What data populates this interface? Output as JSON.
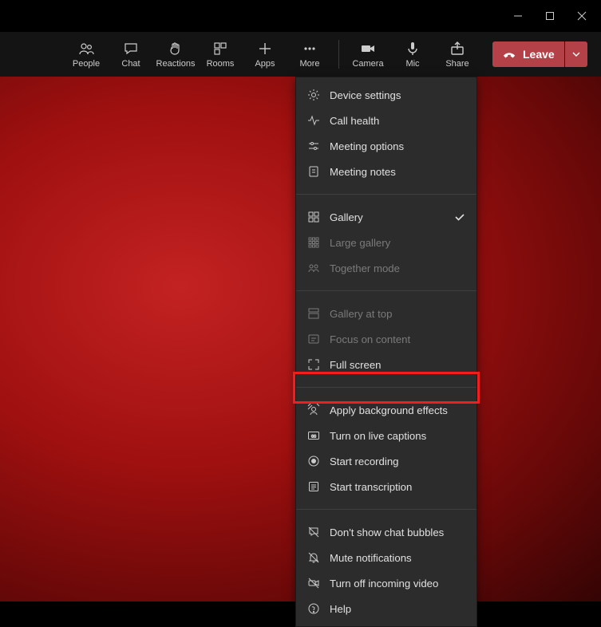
{
  "toolbar": {
    "people": "People",
    "chat": "Chat",
    "reactions": "Reactions",
    "rooms": "Rooms",
    "apps": "Apps",
    "more": "More",
    "camera": "Camera",
    "mic": "Mic",
    "share": "Share",
    "leave": "Leave"
  },
  "menu": {
    "group1": {
      "device_settings": "Device settings",
      "call_health": "Call health",
      "meeting_options": "Meeting options",
      "meeting_notes": "Meeting notes"
    },
    "group2": {
      "gallery": "Gallery",
      "large_gallery": "Large gallery",
      "together_mode": "Together mode"
    },
    "group3": {
      "gallery_at_top": "Gallery at top",
      "focus_on_content": "Focus on content",
      "full_screen": "Full screen"
    },
    "group4": {
      "apply_background": "Apply background effects",
      "live_captions": "Turn on live captions",
      "start_recording": "Start recording",
      "start_transcription": "Start transcription"
    },
    "group5": {
      "dont_show_chat": "Don't show chat bubbles",
      "mute_notifications": "Mute notifications",
      "turn_off_incoming": "Turn off incoming video",
      "help": "Help"
    }
  }
}
